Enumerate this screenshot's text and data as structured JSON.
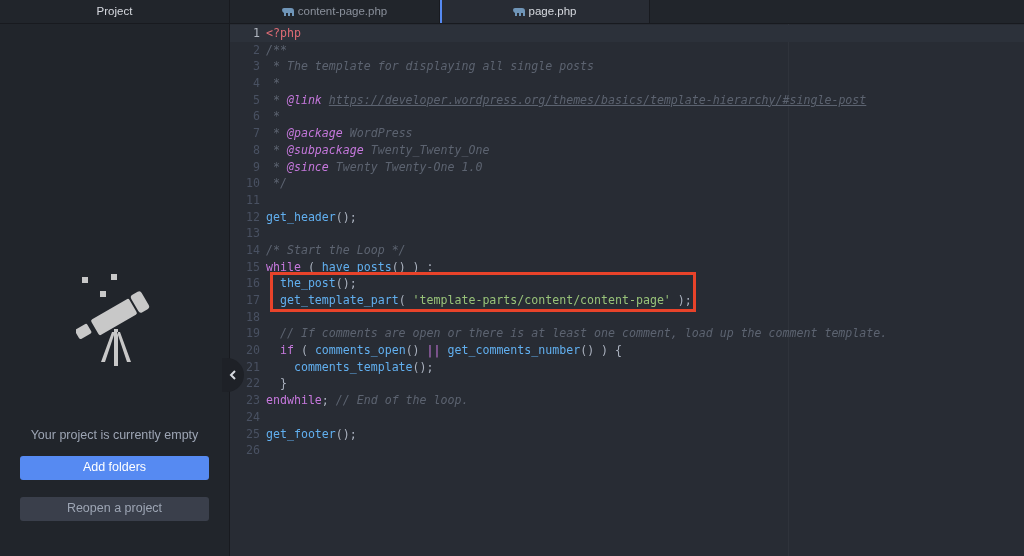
{
  "sidebar": {
    "title": "Project",
    "message": "Your project is currently empty",
    "buttons": [
      {
        "label": "Add folders",
        "kind": "primary"
      },
      {
        "label": "Reopen a project",
        "kind": "secondary"
      }
    ]
  },
  "tabs": [
    {
      "label": "content-page.php",
      "selected": false
    },
    {
      "label": "page.php",
      "selected": true
    }
  ],
  "editor": {
    "lines": [
      {
        "number": "1",
        "current": true,
        "boxed": false,
        "tokens": [
          {
            "kind": "tag",
            "text": "<?php"
          }
        ]
      },
      {
        "number": "2",
        "current": false,
        "boxed": false,
        "tokens": [
          {
            "kind": "comment",
            "text": "/**"
          }
        ]
      },
      {
        "number": "3",
        "current": false,
        "boxed": false,
        "tokens": [
          {
            "kind": "comment",
            "text": " * The template for displaying all single posts"
          }
        ]
      },
      {
        "number": "4",
        "current": false,
        "boxed": false,
        "tokens": [
          {
            "kind": "comment",
            "text": " *"
          }
        ]
      },
      {
        "number": "5",
        "current": false,
        "boxed": false,
        "tokens": [
          {
            "kind": "comment",
            "text": " * "
          },
          {
            "kind": "doctag",
            "text": "@link "
          },
          {
            "kind": "link",
            "text": "https://developer.wordpress.org/themes/basics/template-hierarchy/#single-post"
          }
        ]
      },
      {
        "number": "6",
        "current": false,
        "boxed": false,
        "tokens": [
          {
            "kind": "comment",
            "text": " *"
          }
        ]
      },
      {
        "number": "7",
        "current": false,
        "boxed": false,
        "tokens": [
          {
            "kind": "comment",
            "text": " * "
          },
          {
            "kind": "doctag",
            "text": "@package"
          },
          {
            "kind": "comment",
            "text": " WordPress"
          }
        ]
      },
      {
        "number": "8",
        "current": false,
        "boxed": false,
        "tokens": [
          {
            "kind": "comment",
            "text": " * "
          },
          {
            "kind": "doctag",
            "text": "@subpackage"
          },
          {
            "kind": "comment",
            "text": " Twenty_Twenty_One"
          }
        ]
      },
      {
        "number": "9",
        "current": false,
        "boxed": false,
        "tokens": [
          {
            "kind": "comment",
            "text": " * "
          },
          {
            "kind": "doctag",
            "text": "@since"
          },
          {
            "kind": "comment",
            "text": " Twenty Twenty-One 1.0"
          }
        ]
      },
      {
        "number": "10",
        "current": false,
        "boxed": false,
        "tokens": [
          {
            "kind": "comment",
            "text": " */"
          }
        ]
      },
      {
        "number": "11",
        "current": false,
        "boxed": false
      },
      {
        "number": "12",
        "current": false,
        "boxed": false,
        "tokens": [
          {
            "kind": "func",
            "text": "get_header"
          },
          {
            "kind": "plain",
            "text": "();"
          }
        ]
      },
      {
        "number": "13",
        "current": false,
        "boxed": false
      },
      {
        "number": "14",
        "current": false,
        "boxed": false,
        "tokens": [
          {
            "kind": "comment",
            "text": "/* Start the Loop */"
          }
        ]
      },
      {
        "number": "15",
        "current": false,
        "boxed": false,
        "tokens": [
          {
            "kind": "keyword",
            "text": "while"
          },
          {
            "kind": "plain",
            "text": " ( "
          },
          {
            "kind": "func",
            "text": "have_posts"
          },
          {
            "kind": "plain",
            "text": "() ) :"
          }
        ]
      },
      {
        "number": "16",
        "current": false,
        "boxed": true,
        "tokens": [
          {
            "kind": "func",
            "text": "  the_post"
          },
          {
            "kind": "plain",
            "text": "();"
          }
        ]
      },
      {
        "number": "17",
        "current": false,
        "boxed": true,
        "tokens": [
          {
            "kind": "func",
            "text": "  get_template_part"
          },
          {
            "kind": "plain",
            "text": "( "
          },
          {
            "kind": "string",
            "text": "'template-parts/content/content-page'"
          },
          {
            "kind": "plain",
            "text": " );"
          }
        ]
      },
      {
        "number": "18",
        "current": false,
        "boxed": false
      },
      {
        "number": "19",
        "current": false,
        "boxed": false,
        "tokens": [
          {
            "kind": "comment",
            "text": "  // If comments are open or there is at least one comment, load up the comment template."
          }
        ]
      },
      {
        "number": "20",
        "current": false,
        "boxed": false,
        "tokens": [
          {
            "kind": "keyword",
            "text": "  if"
          },
          {
            "kind": "plain",
            "text": " ( "
          },
          {
            "kind": "func",
            "text": "comments_open"
          },
          {
            "kind": "plain",
            "text": "() "
          },
          {
            "kind": "keyword",
            "text": "|| "
          },
          {
            "kind": "func",
            "text": "get_comments_number"
          },
          {
            "kind": "plain",
            "text": "() ) {"
          }
        ]
      },
      {
        "number": "21",
        "current": false,
        "boxed": false,
        "tokens": [
          {
            "kind": "func",
            "text": "    comments_template"
          },
          {
            "kind": "plain",
            "text": "();"
          }
        ]
      },
      {
        "number": "22",
        "current": false,
        "boxed": false,
        "tokens": [
          {
            "kind": "plain",
            "text": "  }"
          }
        ]
      },
      {
        "number": "23",
        "current": false,
        "boxed": false,
        "tokens": [
          {
            "kind": "keyword",
            "text": "endwhile"
          },
          {
            "kind": "plain",
            "text": "; "
          },
          {
            "kind": "comment",
            "text": "// End of the loop."
          }
        ]
      },
      {
        "number": "24",
        "current": false,
        "boxed": false
      },
      {
        "number": "25",
        "current": false,
        "boxed": false,
        "tokens": [
          {
            "kind": "func",
            "text": "get_footer"
          },
          {
            "kind": "plain",
            "text": "();"
          }
        ]
      },
      {
        "number": "26",
        "current": false,
        "boxed": false
      }
    ]
  }
}
